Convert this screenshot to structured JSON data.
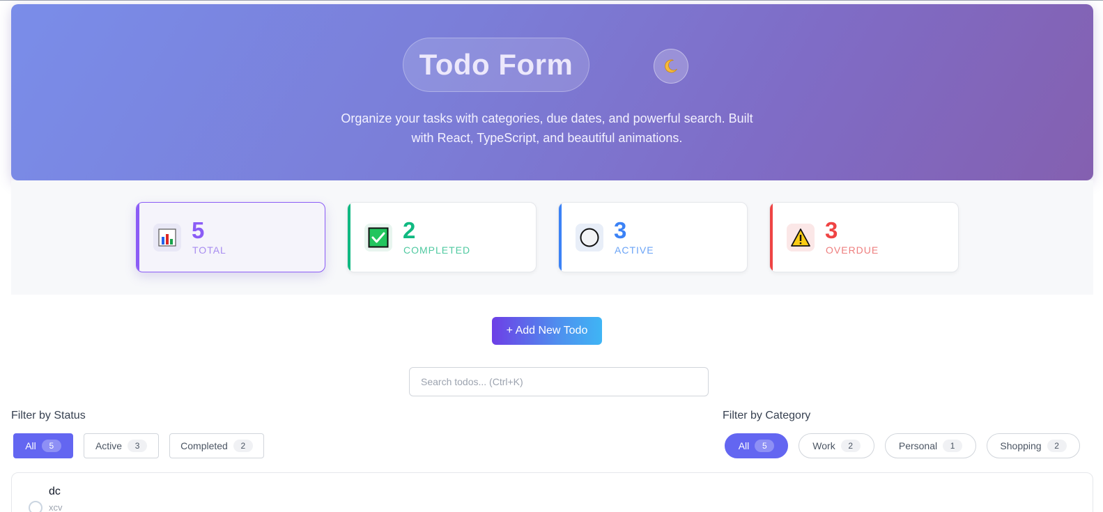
{
  "header": {
    "title": "Todo Form",
    "subtitle": "Organize your tasks with categories, due dates, and powerful search. Built with React, TypeScript, and beautiful animations.",
    "theme_toggle_icon": "moon-icon"
  },
  "stats": [
    {
      "value": "5",
      "label": "TOTAL",
      "icon": "bar-chart-icon",
      "color": "#8b5cf6"
    },
    {
      "value": "2",
      "label": "COMPLETED",
      "icon": "check-box-icon",
      "color": "#10b981"
    },
    {
      "value": "3",
      "label": "ACTIVE",
      "icon": "circle-icon",
      "color": "#3b82f6"
    },
    {
      "value": "3",
      "label": "OVERDUE",
      "icon": "warning-icon",
      "color": "#ef4444"
    }
  ],
  "add_button": {
    "label": "+ Add New Todo"
  },
  "search": {
    "placeholder": "Search todos... (Ctrl+K)"
  },
  "status_filter": {
    "heading": "Filter by Status",
    "options": [
      {
        "label": "All",
        "count": "5"
      },
      {
        "label": "Active",
        "count": "3"
      },
      {
        "label": "Completed",
        "count": "2"
      }
    ],
    "selected": "All"
  },
  "category_filter": {
    "heading": "Filter by Category",
    "options": [
      {
        "label": "All",
        "count": "5"
      },
      {
        "label": "Work",
        "count": "2"
      },
      {
        "label": "Personal",
        "count": "1"
      },
      {
        "label": "Shopping",
        "count": "2"
      }
    ],
    "selected": "All"
  },
  "todos": [
    {
      "title": "dc",
      "description": "xcv"
    }
  ]
}
